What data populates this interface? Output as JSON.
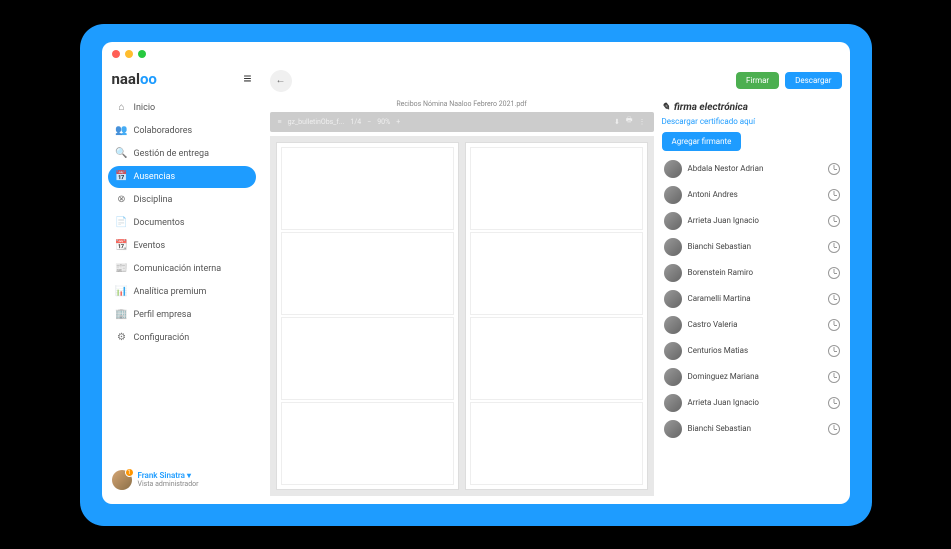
{
  "brand": "naaloo",
  "nav": [
    {
      "icon": "⌂",
      "label": "Inicio"
    },
    {
      "icon": "👥",
      "label": "Colaboradores"
    },
    {
      "icon": "🔍",
      "label": "Gestión de entrega"
    },
    {
      "icon": "📅",
      "label": "Ausencias",
      "active": true
    },
    {
      "icon": "⊗",
      "label": "Disciplina"
    },
    {
      "icon": "📄",
      "label": "Documentos"
    },
    {
      "icon": "📆",
      "label": "Eventos"
    },
    {
      "icon": "📰",
      "label": "Comunicación interna"
    },
    {
      "icon": "📊",
      "label": "Analítica premium"
    },
    {
      "icon": "🏢",
      "label": "Perfil empresa"
    },
    {
      "icon": "⚙",
      "label": "Configuración"
    }
  ],
  "user": {
    "name": "Frank Sinatra",
    "role": "Vista administrador",
    "badge": "1"
  },
  "actions": {
    "sign": "Firmar",
    "download": "Descargar"
  },
  "doc": {
    "title": "Recibos Nómina Naaloo Febrero 2021.pdf",
    "filename": "gz_bulletinObs_f...",
    "page": "1/4",
    "zoom": "90%"
  },
  "signPanel": {
    "title": "firma electrónica",
    "downloadCert": "Descargar certificado aquí",
    "addSigner": "Agregar firmante",
    "signers": [
      "Abdala Nestor Adrian",
      "Antoni Andres",
      "Arrieta Juan Ignacio",
      "Bianchi Sebastian",
      "Borenstein Ramiro",
      "Caramelli Martina",
      "Castro Valeria",
      "Centurios Matias",
      "Dominguez Mariana",
      "Arrieta Juan Ignacio",
      "Bianchi Sebastian"
    ]
  }
}
